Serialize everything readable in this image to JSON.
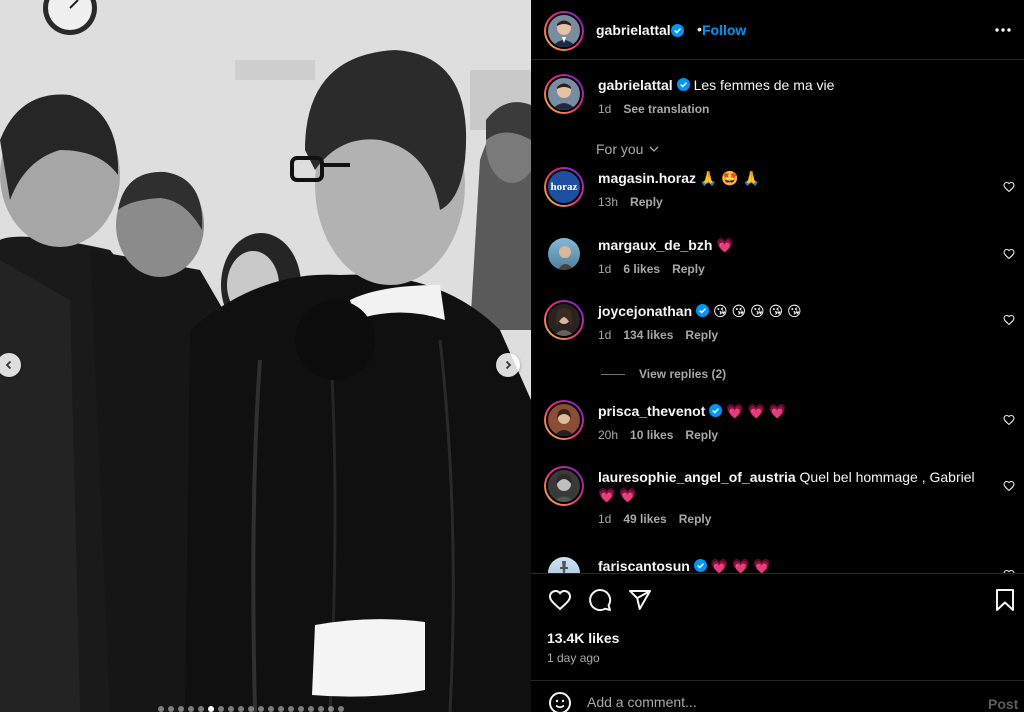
{
  "post": {
    "author": "gabrielattal",
    "separator": "•",
    "follow_label": "Follow",
    "caption": "Les femmes de ma vie",
    "caption_age": "1d",
    "see_translation": "See translation",
    "filter_label": "For you",
    "likes": "13.4K likes",
    "posted": "1 day ago",
    "add_comment_placeholder": "Add a comment...",
    "post_label": "Post"
  },
  "comments": [
    {
      "user": "magasin.horaz",
      "text": "🙏 🤩 🙏",
      "age": "13h",
      "likes": "",
      "reply": "Reply",
      "verified": false
    },
    {
      "user": "margaux_de_bzh",
      "text": "💗",
      "age": "1d",
      "likes": "6 likes",
      "reply": "Reply",
      "verified": false
    },
    {
      "user": "joycejonathan",
      "text": "😘 😘 😘 😘 😘",
      "age": "1d",
      "likes": "134 likes",
      "reply": "Reply",
      "verified": true
    },
    {
      "user": "prisca_thevenot",
      "text": "💗 💗 💗",
      "age": "20h",
      "likes": "10 likes",
      "reply": "Reply",
      "verified": true
    },
    {
      "user": "lauresophie_angel_of_austria",
      "text": "Quel bel hommage , Gabriel 💗 💗",
      "age": "1d",
      "likes": "49 likes",
      "reply": "Reply",
      "verified": false
    },
    {
      "user": "fariscantosun",
      "text": "💗 💗 💗",
      "age": "",
      "likes": "",
      "reply": "",
      "verified": true
    }
  ],
  "view_replies": "View replies (2)",
  "horaz_logo_text": "horaz",
  "colors": {
    "follow": "#0095f6",
    "verified": "#0095f6",
    "background": "#000000",
    "muted": "#a8a8a8"
  },
  "icons": [
    "more-options-icon",
    "verified-badge-icon",
    "chevron-down-icon",
    "heart-icon",
    "comment-icon",
    "share-icon",
    "bookmark-icon",
    "emoji-icon",
    "chevron-left-icon",
    "chevron-right-icon"
  ]
}
